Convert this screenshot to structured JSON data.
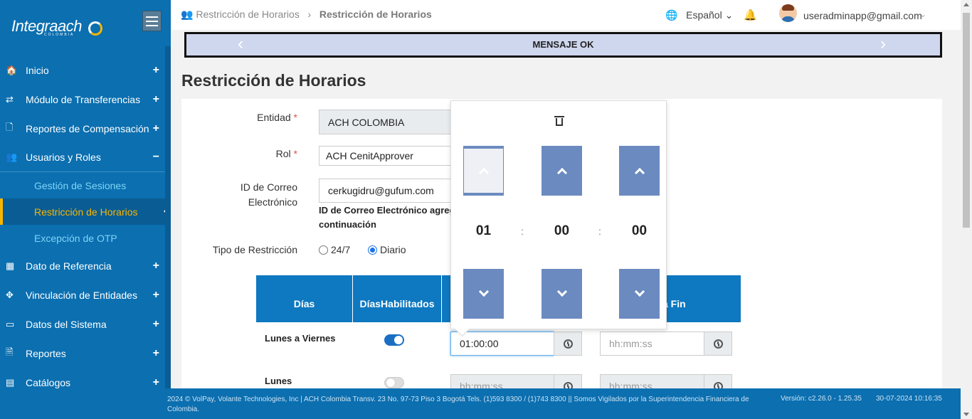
{
  "sidebar": {
    "logo_text": "Integraach",
    "logo_sub": "COLOMBIA",
    "items": [
      {
        "icon": "home-icon",
        "glyph": "🏠",
        "label": "Inicio",
        "toggle": "+"
      },
      {
        "icon": "transfer-icon",
        "glyph": "⇄",
        "label": "Módulo de Transferencias",
        "toggle": "+"
      },
      {
        "icon": "file-icon",
        "glyph": "🗋",
        "label": "Reportes de Compensación",
        "toggle": "+"
      },
      {
        "icon": "users-icon",
        "glyph": "👥",
        "label": "Usuarios y Roles",
        "toggle": "−"
      },
      {
        "icon": "calendar-icon",
        "glyph": "▦",
        "label": "Dato de Referencia",
        "toggle": "+"
      },
      {
        "icon": "link-icon",
        "glyph": "✥",
        "label": "Vinculación de Entidades",
        "toggle": "+"
      },
      {
        "icon": "monitor-icon",
        "glyph": "▭",
        "label": "Datos del Sistema",
        "toggle": "+"
      },
      {
        "icon": "report-icon",
        "glyph": "🗎",
        "label": "Reportes",
        "toggle": "+"
      },
      {
        "icon": "catalog-icon",
        "glyph": "▤",
        "label": "Catálogos",
        "toggle": "+"
      }
    ],
    "sub_items": [
      {
        "label": "Gestión de Sesiones"
      },
      {
        "label": "Restricción de Horarios"
      },
      {
        "label": "Excepción de OTP"
      }
    ]
  },
  "header": {
    "breadcrumb_parent": "Restricción de Horarios",
    "breadcrumb_current": "Restricción de Horarios",
    "language": "Español",
    "user_email": "useradminapp@gmail.com"
  },
  "banner": {
    "message": "MENSAJE OK"
  },
  "page": {
    "title": "Restricción de Horarios"
  },
  "form": {
    "entidad_label": "Entidad",
    "entidad_value": "ACH COLOMBIA",
    "rol_label": "Rol",
    "rol_value": "ACH CenitApprover",
    "email_label_1": "ID de Correo",
    "email_label_2": "Electrónico",
    "email_value": "cerkugidru@gufum.com",
    "email_help_1": "ID de Correo Electrónico agreg",
    "email_help_2": "continuación",
    "tipo_label": "Tipo de Restricción",
    "option_247": "24/7",
    "option_diario": "Diario",
    "selected": "Diario"
  },
  "table": {
    "headers": [
      "Días",
      "Días Habilitados",
      "",
      "a Fin"
    ],
    "header_dias_hab_1": "Días",
    "header_dias_hab_2": "Habilitados",
    "rows": [
      {
        "label": "Lunes a Viernes",
        "enabled": true,
        "start": "01:00:00",
        "end_placeholder": "hh:mm:ss"
      },
      {
        "label": "Lunes",
        "enabled": false,
        "start_placeholder": "hh:mm:ss",
        "end_placeholder": "hh:mm:ss"
      }
    ]
  },
  "timepicker": {
    "hours": "01",
    "minutes": "00",
    "seconds": "00",
    "separator": ":"
  },
  "footer": {
    "text": "2024 © VolPay, Volante Technologies, Inc | ACH Colombia Transv. 23 No. 97-73 Piso 3 Bogotá Tels. (1)593 8300 / (1)743 8300 || Somos Vigilados por la Superintendencia Financiera de Colombia.",
    "version": "Versión: c2.26.0 - 1.25.35",
    "datetime": "30-07-2024 10:16:35"
  },
  "colors": {
    "sidebar": "#0b6fb0",
    "active": "#f7b500",
    "table_header": "#0e78c0",
    "picker_button": "#6b8ac0"
  }
}
